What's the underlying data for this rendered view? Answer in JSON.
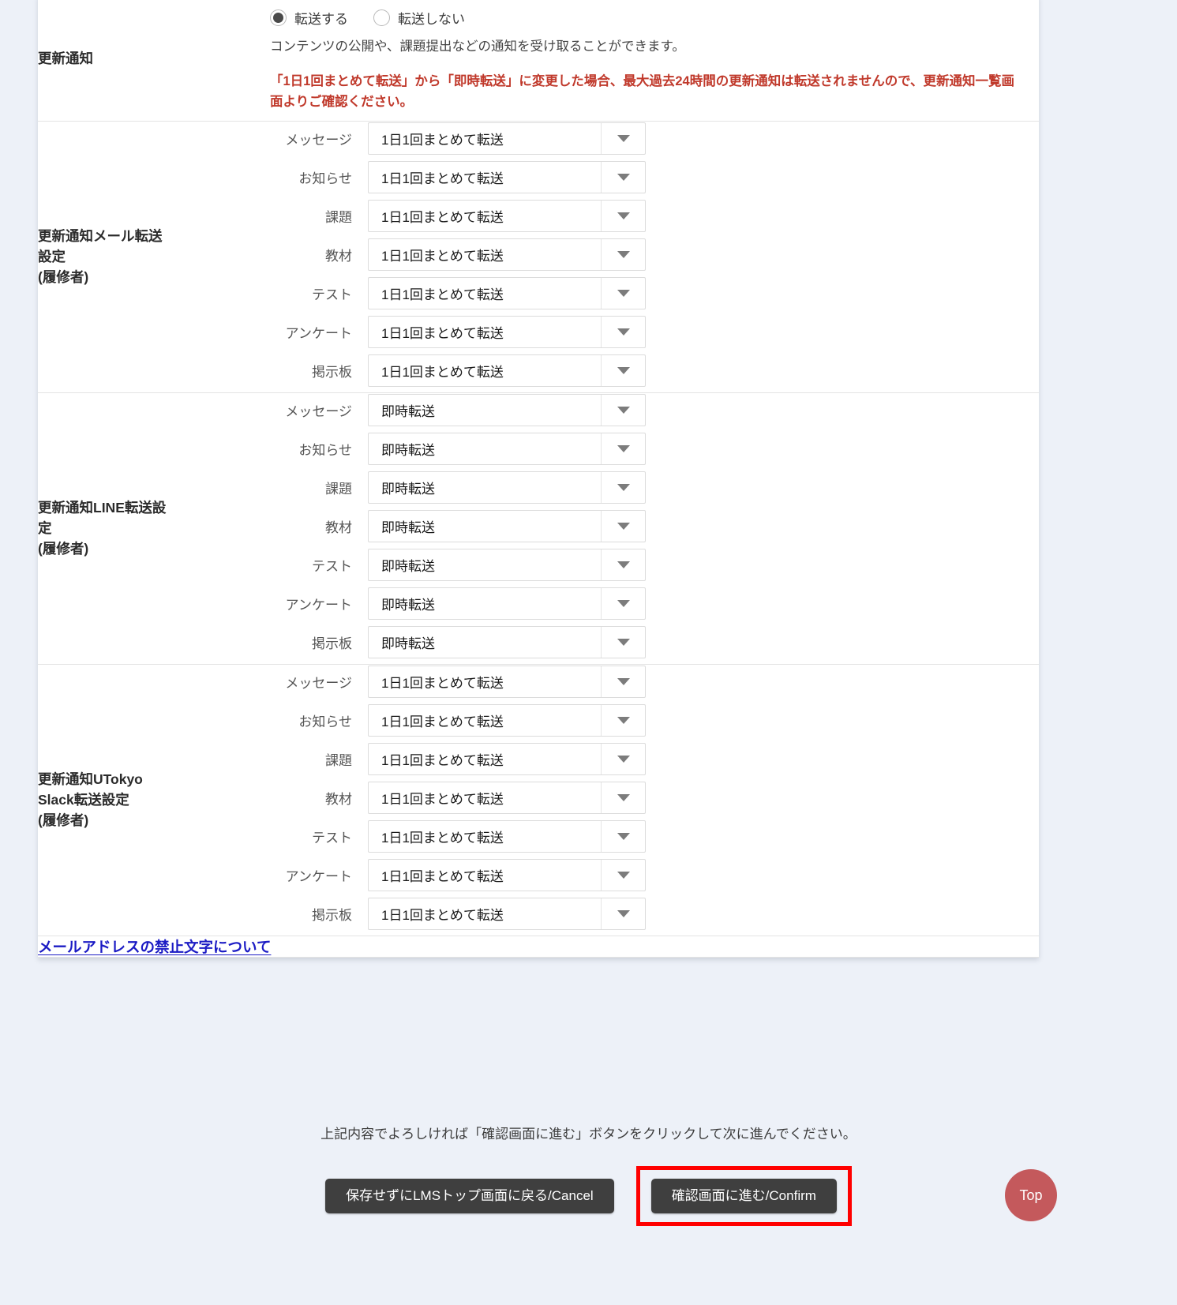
{
  "notification": {
    "label": "更新通知",
    "radios": [
      {
        "label": "転送する",
        "checked": true
      },
      {
        "label": "転送しない",
        "checked": false
      }
    ],
    "description": "コンテンツの公開や、課題提出などの通知を受け取ることができます。",
    "warning": "「1日1回まとめて転送」から「即時転送」に変更した場合、最大過去24時間の更新通知は転送されませんので、更新通知一覧画面よりご確認ください。"
  },
  "sections": [
    {
      "label": "更新通知メール転送設定\n(履修者)",
      "label_line1": "更新通知メール転送",
      "label_line2": "設定",
      "label_line3": "(履修者)",
      "rows": [
        {
          "label": "メッセージ",
          "value": "1日1回まとめて転送"
        },
        {
          "label": "お知らせ",
          "value": "1日1回まとめて転送"
        },
        {
          "label": "課題",
          "value": "1日1回まとめて転送"
        },
        {
          "label": "教材",
          "value": "1日1回まとめて転送"
        },
        {
          "label": "テスト",
          "value": "1日1回まとめて転送"
        },
        {
          "label": "アンケート",
          "value": "1日1回まとめて転送"
        },
        {
          "label": "掲示板",
          "value": "1日1回まとめて転送"
        }
      ]
    },
    {
      "label": "更新通知LINE転送設定\n(履修者)",
      "label_line1": "更新通知LINE転送設",
      "label_line2": "定",
      "label_line3": "(履修者)",
      "rows": [
        {
          "label": "メッセージ",
          "value": "即時転送"
        },
        {
          "label": "お知らせ",
          "value": "即時転送"
        },
        {
          "label": "課題",
          "value": "即時転送"
        },
        {
          "label": "教材",
          "value": "即時転送"
        },
        {
          "label": "テスト",
          "value": "即時転送"
        },
        {
          "label": "アンケート",
          "value": "即時転送"
        },
        {
          "label": "掲示板",
          "value": "即時転送"
        }
      ]
    },
    {
      "label": "更新通知UTokyo Slack転送設定\n(履修者)",
      "label_line1": "更新通知UTokyo",
      "label_line2": "Slack転送設定",
      "label_line3": "(履修者)",
      "rows": [
        {
          "label": "メッセージ",
          "value": "1日1回まとめて転送"
        },
        {
          "label": "お知らせ",
          "value": "1日1回まとめて転送"
        },
        {
          "label": "課題",
          "value": "1日1回まとめて転送"
        },
        {
          "label": "教材",
          "value": "1日1回まとめて転送"
        },
        {
          "label": "テスト",
          "value": "1日1回まとめて転送"
        },
        {
          "label": "アンケート",
          "value": "1日1回まとめて転送"
        },
        {
          "label": "掲示板",
          "value": "1日1回まとめて転送"
        }
      ]
    }
  ],
  "prohibited_chars_link": "メールアドレスの禁止文字について",
  "footer": {
    "note": "上記内容でよろしければ「確認画面に進む」ボタンをクリックして次に進んでください。",
    "cancel_label": "保存せずにLMSトップ画面に戻る/Cancel",
    "confirm_label": "確認画面に進む/Confirm",
    "top_label": "Top"
  },
  "colors": {
    "warning_red": "#c0392b",
    "highlight_red": "#ff0000",
    "link_blue": "#1b1bc4",
    "button_dark": "#3f3f3f",
    "top_button": "#c4595c",
    "page_bg": "#edf1f8"
  }
}
